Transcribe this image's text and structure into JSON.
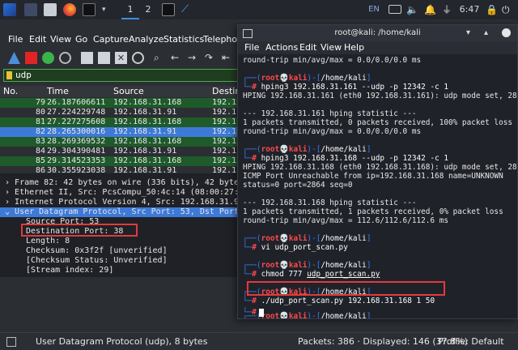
{
  "taskbar": {
    "workspaces": [
      "1",
      "2"
    ],
    "lang": "EN",
    "time": "6:47"
  },
  "wireshark": {
    "menu": [
      "File",
      "Edit",
      "View",
      "Go",
      "Capture",
      "Analyze",
      "Statistics",
      "Telephon"
    ],
    "filter": "udp",
    "columns": [
      "No.",
      "Time",
      "Source",
      "Destin"
    ],
    "packets": [
      {
        "no": "79",
        "time": "26.187606611",
        "src": "192.168.31.168",
        "dst": "192.1"
      },
      {
        "no": "80",
        "time": "27.224229748",
        "src": "192.168.31.91",
        "dst": "192.1"
      },
      {
        "no": "81",
        "time": "27.227275608",
        "src": "192.168.31.168",
        "dst": "192.1"
      },
      {
        "no": "82",
        "time": "28.265300016",
        "src": "192.168.31.91",
        "dst": "192.1"
      },
      {
        "no": "83",
        "time": "28.269369532",
        "src": "192.168.31.168",
        "dst": "192.1"
      },
      {
        "no": "84",
        "time": "29.304390481",
        "src": "192.168.31.91",
        "dst": "192.1"
      },
      {
        "no": "85",
        "time": "29.314523353",
        "src": "192.168.31.168",
        "dst": "192.1"
      },
      {
        "no": "86",
        "time": "30.355923038",
        "src": "192.168.31.91",
        "dst": "192.1"
      }
    ],
    "details": [
      "Frame 82: 42 bytes on wire (336 bits), 42 bytes",
      "Ethernet II, Src: PcsCompu_50:4c:14 (08:00:27:5",
      "Internet Protocol Version 4, Src: 192.168.31.91",
      "User Datagram Protocol, Src Port: 53, Dst Port:",
      "Source Port: 53",
      "Destination Port: 38",
      "Length: 8",
      "Checksum: 0x3f2f [unverified]",
      "[Checksum Status: Unverified]",
      "[Stream index: 29]"
    ],
    "status_left": "User Datagram Protocol (udp), 8 bytes",
    "status_packets": "Packets: 386 · Displayed: 146 (37.8%)",
    "status_profile": "Profile: Default"
  },
  "terminal": {
    "title": "root@kali: /home/kali",
    "menu": [
      "File",
      "Actions",
      "Edit",
      "View",
      "Help"
    ],
    "prompt_user": "root",
    "prompt_host": "kali",
    "prompt_dir": "/home/kali",
    "lines": {
      "l0": "round-trip min/avg/max = 0.0/0.0/0.0 ms",
      "c1": "hping3 192.168.31.161 --udp -p 12342 -c 1",
      "o1a": "HPING 192.168.31.161 (eth0 192.168.31.161): udp mode set, 28 heade",
      "o1b": "--- 192.168.31.161 hping statistic ---",
      "o1c": "1 packets transmitted, 0 packets received, 100% packet loss",
      "o1d": "round-trip min/avg/max = 0.0/0.0/0.0 ms",
      "c2": "hping3 192.168.31.168 --udp -p 12342 -c 1",
      "o2a": "HPING 192.168.31.168 (eth0 192.168.31.168): udp mode set, 28 heade",
      "o2b": "ICMP Port Unreachable from ip=192.168.31.168 name=UNKNOWN",
      "o2c": "status=0 port=2864 seq=0",
      "o2d": "--- 192.168.31.168 hping statistic ---",
      "o2e": "1 packets transmitted, 1 packets received, 0% packet loss",
      "o2f": "round-trip min/avg/max = 112.6/112.6/112.6 ms",
      "c3": "vi udp_port_scan.py",
      "c4a": "chmod 777 ",
      "c4b": "udp_port_scan.py",
      "c5": "./udp_port_scan.py 192.168.31.168 1 50"
    }
  },
  "colors": {
    "packet_green": "#1f5a2a",
    "packet_dark": "#2b2e33",
    "packet_selected": "#3d7ad8",
    "prompt_blue": "#3c7cf0",
    "prompt_red": "#ff4a4a",
    "highlight_red": "#e23a3a"
  }
}
